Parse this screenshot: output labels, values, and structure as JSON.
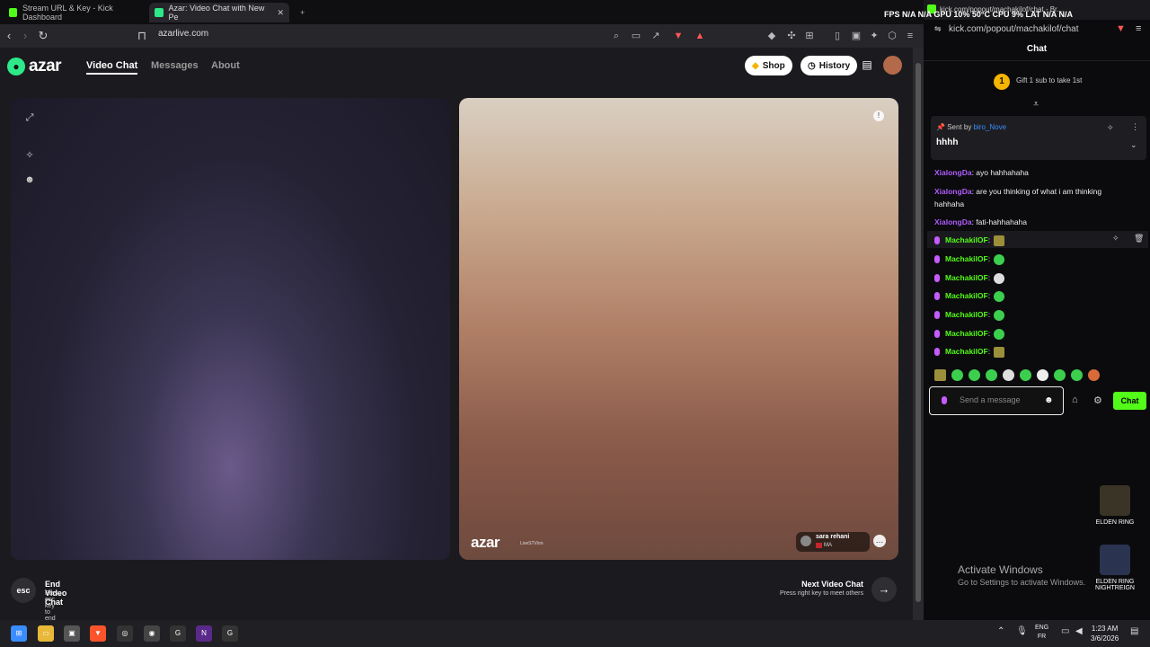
{
  "browser": {
    "tabs": [
      {
        "label": "Stream URL & Key - Kick Dashboard",
        "color": "#53fc18"
      },
      {
        "label": "Azar: Video Chat with New Pe",
        "color": "#2ee88a"
      }
    ],
    "url": "azarlive.com"
  },
  "azar": {
    "logo": "azar",
    "nav": [
      "Video Chat",
      "Messages",
      "About"
    ],
    "shop_label": "Shop",
    "history_label": "History",
    "watermark": "azar",
    "watermark_sub": "LiveSTVion",
    "peer_name": "sara rehani",
    "peer_country": "MA",
    "esc_key": "esc",
    "end_title": "End Video Chat",
    "end_sub": "Press esc key to end video chat",
    "next_title": "Next Video Chat",
    "next_sub": "Press right key to meet others"
  },
  "kick": {
    "window_title": "kick.com/popout/machakilof/chat - Br...",
    "url": "kick.com/popout/machakilof/chat",
    "header": "Chat",
    "gift_count": "1",
    "gift_text": "Gift 1 sub to take 1st",
    "pinned_prefix": "Sent by ",
    "pinned_user": "biro_Nove",
    "pinned_message": "hhhh",
    "messages": [
      {
        "user": "XialongDa",
        "text": ": ayo hahhahaha",
        "color": "#b05cff"
      },
      {
        "user": "XialongDa",
        "text": ": are you thinking of what i am thinking hahhaha",
        "color": "#b05cff"
      },
      {
        "user": "XialongDa",
        "text": ": fati-hahhahaha",
        "color": "#b05cff"
      },
      {
        "user": "MachakilOF",
        "text": ":",
        "color": "#53fc18"
      },
      {
        "user": "MachakilOF",
        "text": ":",
        "color": "#53fc18"
      },
      {
        "user": "MachakilOF",
        "text": ":",
        "color": "#53fc18"
      },
      {
        "user": "MachakilOF",
        "text": ":",
        "color": "#53fc18"
      },
      {
        "user": "MachakilOF",
        "text": ":",
        "color": "#53fc18"
      },
      {
        "user": "MachakilOF",
        "text": ":",
        "color": "#53fc18"
      },
      {
        "user": "MachakilOF",
        "text": ":",
        "color": "#53fc18"
      }
    ],
    "input_placeholder": "Send a message",
    "send_label": "Chat"
  },
  "overlay_stats": "FPS N/A N/A   GPU 10% 50°C   CPU 9%   LAT N/A N/A",
  "desktop": {
    "icons": [
      "ELDEN RING",
      "ELDEN RING NIGHTREIGN"
    ],
    "activate_title": "Activate Windows",
    "activate_sub": "Go to Settings to activate Windows."
  },
  "taskbar": {
    "lang_1": "ENG",
    "lang_2": "FR",
    "time": "1:23 AM",
    "date": "3/6/2026"
  }
}
